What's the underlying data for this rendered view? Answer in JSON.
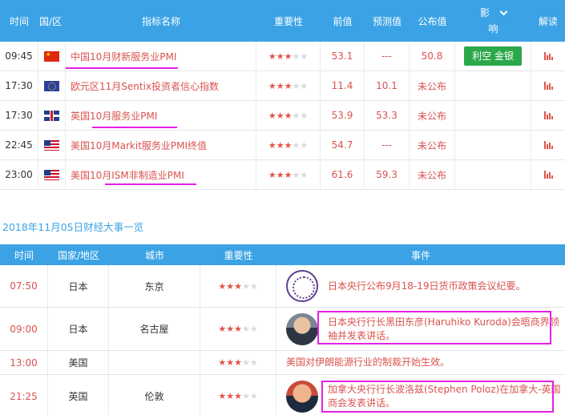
{
  "top_table": {
    "headers": {
      "time": "时间",
      "country": "国/区",
      "indicator": "指标名称",
      "importance": "重要性",
      "previous": "前值",
      "forecast": "预测值",
      "published": "公布值",
      "effect_line1": "影",
      "effect_line2": "响",
      "interpret": "解读"
    },
    "rows": [
      {
        "time": "09:45",
        "flag": "cn",
        "name": "中国10月财新服务业PMI",
        "stars": 3,
        "previous": "53.1",
        "forecast": "---",
        "published": "50.8",
        "effect": "利空 金银"
      },
      {
        "time": "17:30",
        "flag": "eu",
        "name": "欧元区11月Sentix投资者信心指数",
        "stars": 3,
        "previous": "11.4",
        "forecast": "10.1",
        "published": "未公布",
        "effect": ""
      },
      {
        "time": "17:30",
        "flag": "uk",
        "name": "英国10月服务业PMI",
        "stars": 3,
        "previous": "53.9",
        "forecast": "53.3",
        "published": "未公布",
        "effect": ""
      },
      {
        "time": "22:45",
        "flag": "us",
        "name": "美国10月Markit服务业PMI终值",
        "stars": 3,
        "previous": "54.7",
        "forecast": "---",
        "published": "未公布",
        "effect": ""
      },
      {
        "time": "23:00",
        "flag": "us",
        "name": "美国10月ISM非制造业PMI",
        "stars": 3,
        "previous": "61.6",
        "forecast": "59.3",
        "published": "未公布",
        "effect": ""
      }
    ]
  },
  "section_title": "2018年11月05日财经大事一览",
  "events_table": {
    "headers": {
      "time": "时间",
      "country": "国家/地区",
      "city": "城市",
      "importance": "重要性",
      "event": "事件"
    },
    "rows": [
      {
        "time": "07:50",
        "country": "日本",
        "city": "东京",
        "stars": 3,
        "avatar": "seal",
        "event": "日本央行公布9月18-19日货币政策会议纪要。"
      },
      {
        "time": "09:00",
        "country": "日本",
        "city": "名古屋",
        "stars": 3,
        "avatar": "face1",
        "event": "日本央行行长黑田东彦(Haruhiko Kuroda)会晤商界领袖并发表讲话。"
      },
      {
        "time": "13:00",
        "country": "美国",
        "city": "",
        "stars": 3,
        "avatar": "",
        "event": "美国对伊朗能源行业的制裁开始生效。"
      },
      {
        "time": "21:25",
        "country": "英国",
        "city": "伦敦",
        "stars": 3,
        "avatar": "face2",
        "event": "加拿大央行行长波洛兹(Stephen Poloz)在加拿大-英国商会发表讲话。"
      }
    ]
  },
  "colors": {
    "header_blue": "#3ba3e5",
    "value_red": "#d9534f",
    "effect_green": "#2ba84a",
    "annotation_magenta": "#e620e6"
  },
  "total_stars": 5
}
